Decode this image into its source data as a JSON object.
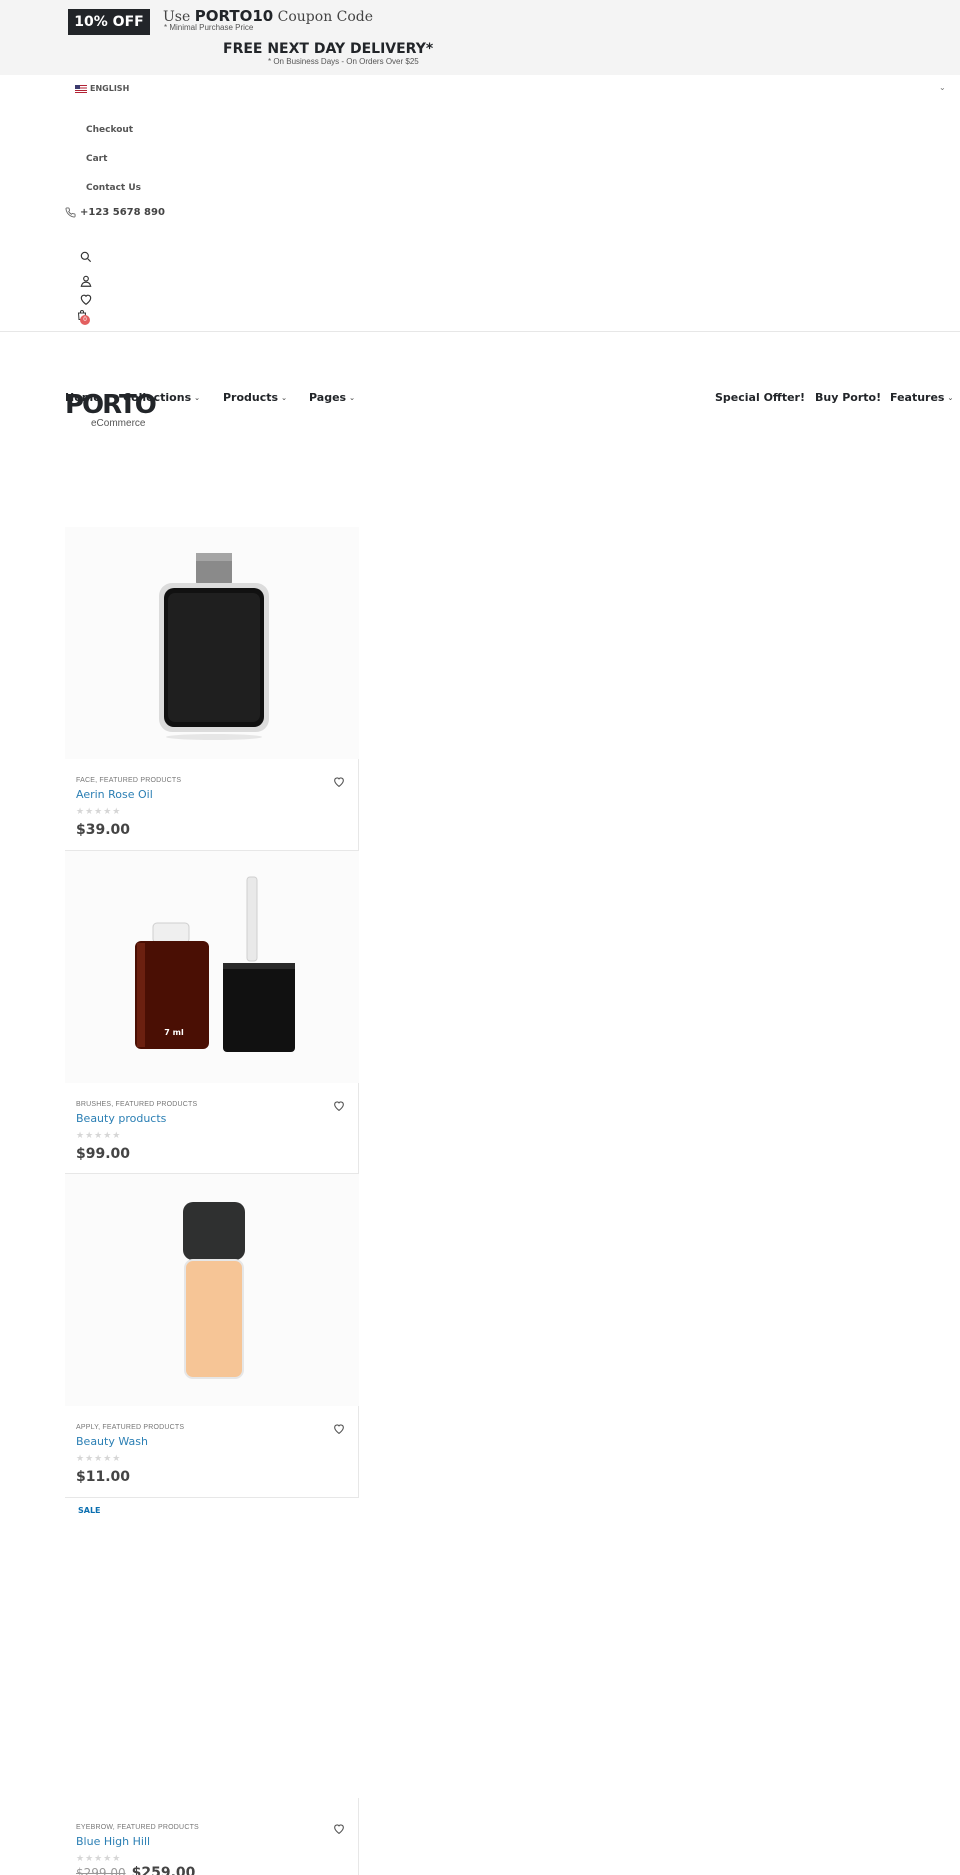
{
  "promo": {
    "badge": "10% OFF",
    "coupon_prefix": "Use ",
    "coupon_code": "PORTO10",
    "coupon_suffix": " Coupon Code",
    "min_purchase": "* Minimal Purchase Price",
    "free_delivery": "FREE NEXT DAY DELIVERY*",
    "business_days": "* On Business Days - On Orders Over $25"
  },
  "header": {
    "language": "ENGLISH",
    "links": [
      "Checkout",
      "Cart",
      "Contact Us"
    ],
    "phone": "+123 5678 890",
    "cart_count": "0"
  },
  "logo": {
    "name": "PORTO",
    "sub": "eCommerce"
  },
  "nav": {
    "left": [
      "Home",
      "Collections",
      "Products",
      "Pages"
    ],
    "right": [
      "Special Offter!",
      "Buy Porto!",
      "Features"
    ]
  },
  "products": [
    {
      "category": "FACE, FEATURED PRODUCTS",
      "title": "Aerin Rose Oil",
      "price": "$39.00",
      "old_price": "",
      "sale": "",
      "stars": "★★★★★"
    },
    {
      "category": "BRUSHES, FEATURED PRODUCTS",
      "title": "Beauty products",
      "price": "$99.00",
      "old_price": "",
      "sale": "",
      "stars": "★★★★★",
      "bottle_label": "7 ml"
    },
    {
      "category": "APPLY, FEATURED PRODUCTS",
      "title": "Beauty Wash",
      "price": "$11.00",
      "old_price": "",
      "sale": "",
      "stars": "★★★★★"
    },
    {
      "category": "EYEBROW, FEATURED PRODUCTS",
      "title": "Blue High Hill",
      "price": "$259.00",
      "old_price": "$299.00",
      "sale": "SALE",
      "stars": "★★★★★"
    }
  ],
  "colors": {
    "dark": "#222529",
    "link": "#2b7fb4",
    "badge": "#e35f5f"
  }
}
